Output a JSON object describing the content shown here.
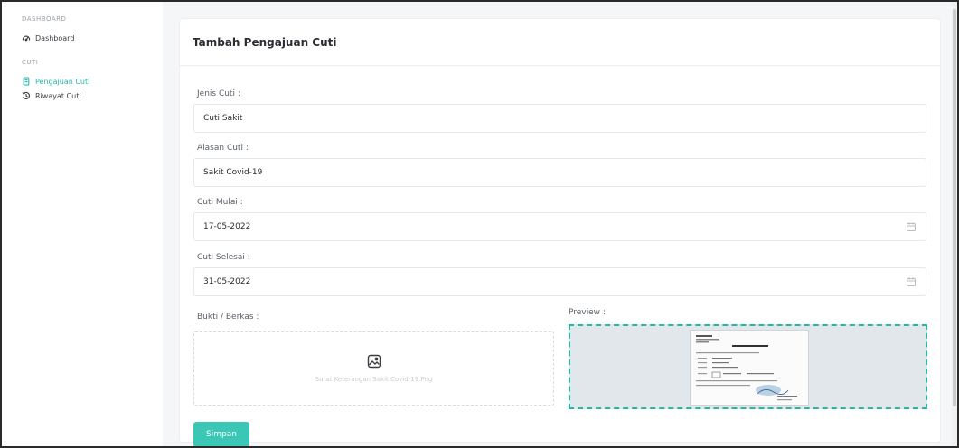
{
  "sidebar": {
    "sections": [
      {
        "heading": "DASHBOARD",
        "items": [
          {
            "label": "Dashboard",
            "icon": "dashboard-icon",
            "active": false
          }
        ]
      },
      {
        "heading": "CUTI",
        "items": [
          {
            "label": "Pengajuan Cuti",
            "icon": "document-icon",
            "active": true
          },
          {
            "label": "Riwayat Cuti",
            "icon": "history-icon",
            "active": false
          }
        ]
      }
    ]
  },
  "form": {
    "title": "Tambah Pengajuan Cuti",
    "jenis_label": "Jenis Cuti :",
    "jenis_value": "Cuti Sakit",
    "alasan_label": "Alasan Cuti :",
    "alasan_value": "Sakit Covid-19",
    "mulai_label": "Cuti Mulai :",
    "mulai_value": "17-05-2022",
    "selesai_label": "Cuti Selesai :",
    "selesai_value": "31-05-2022",
    "bukti_label": "Bukti / Berkas :",
    "bukti_file": "Surat Keterangan Sakit Covid-19.Png",
    "preview_label": "Preview :",
    "save_label": "Simpan"
  },
  "colors": {
    "accent": "#27b7a5",
    "button": "#3bc7b6"
  }
}
